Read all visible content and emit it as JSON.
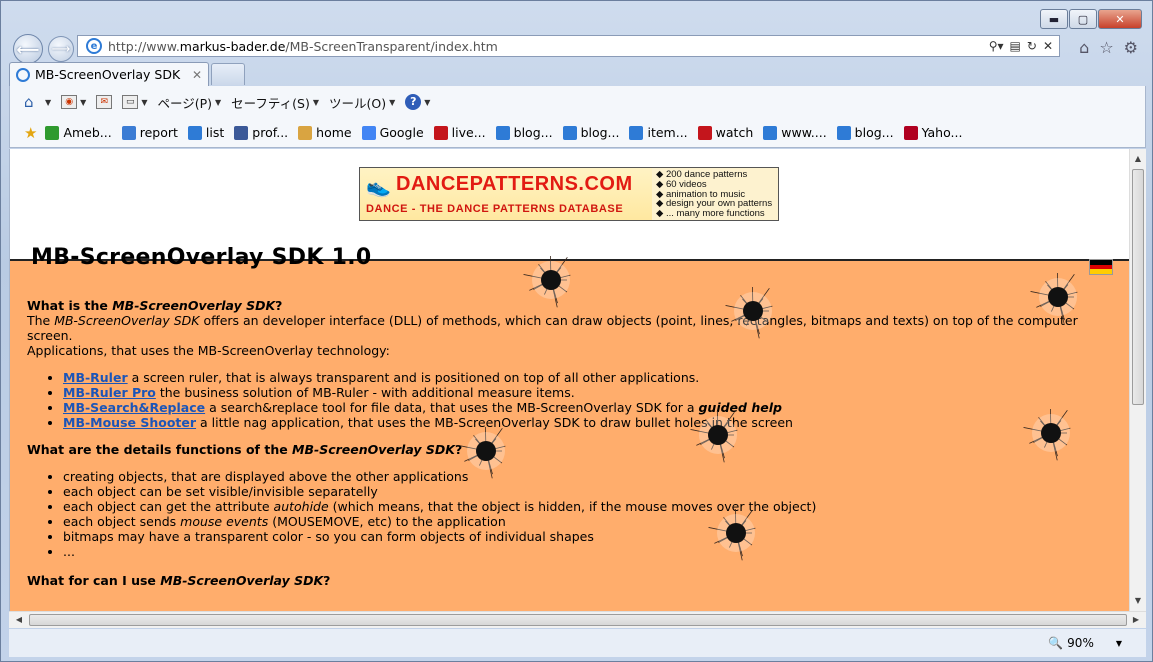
{
  "window": {
    "minimize_label": "▬",
    "maximize_label": "▢",
    "close_label": "✕"
  },
  "address": {
    "url_prefix": "http://www.",
    "url_host": "markus-bader.de",
    "url_path": "/MB-ScreenTransparent/index.htm"
  },
  "tab": {
    "title": "MB-ScreenOverlay SDK",
    "close": "✕"
  },
  "commandbar": {
    "page_label": "ページ(P)",
    "safety_label": "セーフティ(S)",
    "tools_label": "ツール(O)",
    "help_label": "?"
  },
  "favorites": [
    {
      "label": "Ameb...",
      "color": "#2f9a2f",
      "icon": "clover-icon"
    },
    {
      "label": "report",
      "color": "#3b7cd4",
      "icon": "report-icon"
    },
    {
      "label": "list",
      "color": "#2e7bd6",
      "icon": "ie-page-icon"
    },
    {
      "label": "prof...",
      "color": "#3b5998",
      "icon": "facebook-icon"
    },
    {
      "label": "home",
      "color": "#d9a441",
      "icon": "mixi-icon"
    },
    {
      "label": "Google",
      "color": "#4285f4",
      "icon": "google-icon"
    },
    {
      "label": "live...",
      "color": "#c4151c",
      "icon": "live-icon"
    },
    {
      "label": "blog...",
      "color": "#2e7bd6",
      "icon": "ie-page-icon"
    },
    {
      "label": "blog...",
      "color": "#2e7bd6",
      "icon": "ie-page-icon"
    },
    {
      "label": "item...",
      "color": "#2e7bd6",
      "icon": "ie-page-icon"
    },
    {
      "label": "watch",
      "color": "#c4151c",
      "icon": "youtube-icon"
    },
    {
      "label": "www....",
      "color": "#2e7bd6",
      "icon": "ie-page-icon"
    },
    {
      "label": "blog...",
      "color": "#2e7bd6",
      "icon": "ie-page-icon"
    },
    {
      "label": "Yaho...",
      "color": "#b00020",
      "icon": "yahoo-icon"
    }
  ],
  "banner": {
    "title": "DANCEPATTERNS.COM",
    "subtitle": "DANCE - THE DANCE PATTERNS DATABASE",
    "bullets": [
      "◆ 200 dance patterns",
      "◆ 60 videos",
      "◆ animation to music",
      "◆ design your own patterns",
      "◆ ... many more functions"
    ]
  },
  "page": {
    "title": "MB-ScreenOverlay SDK 1.0",
    "q1_prefix": "What is the ",
    "q1_italic": "MB-ScreenOverlay SDK",
    "q1_suffix": "?",
    "intro_prefix": "The ",
    "intro_italic": "MB-ScreenOverlay SDK",
    "intro_rest": " offers an developer interface (DLL) of methods, which can draw objects (point, lines, rectangles, bitmaps and texts) on top of the computer screen.",
    "intro_line2": "Applications, that uses the MB-ScreenOverlay technology:",
    "apps": [
      {
        "link": "MB-Ruler",
        "text": " a screen ruler, that is always transparent and is positioned on top of all other applications."
      },
      {
        "link": "MB-Ruler Pro",
        "text": " the business solution of MB-Ruler - with additional measure items."
      },
      {
        "link": "MB-Search&Replace",
        "text": " a search&replace tool for file data, that uses the MB-ScreenOverlay SDK for a ",
        "em": "guided help"
      },
      {
        "link": "MB-Mouse Shooter",
        "text": " a little nag application, that uses the MB-ScreenOverlay SDK to draw bullet holes in the screen"
      }
    ],
    "q2_prefix": "What are the details functions of the ",
    "q2_italic": "MB-ScreenOverlay SDK",
    "q2_suffix": "?",
    "features": [
      {
        "text": "creating objects, that are displayed above the other applications"
      },
      {
        "text": "each object can be set visible/invisible separatelly"
      },
      {
        "pre": "each object can get the attribute ",
        "em": "autohide",
        "post": " (which means, that the object is hidden, if the mouse moves over the object)"
      },
      {
        "pre": "each object sends ",
        "em": "mouse events",
        "post": " (MOUSEMOVE, etc) to the application"
      },
      {
        "text": "bitmaps may have a transparent color - so you can form objects of individual shapes"
      },
      {
        "text": "..."
      }
    ],
    "q3_prefix": "What for can I use ",
    "q3_italic": "MB-ScreenOverlay SDK",
    "q3_suffix": "?"
  },
  "status": {
    "zoom": "90%"
  },
  "colors": {
    "page_bg": "#ffad6c",
    "link": "#1c55b8",
    "banner_red": "#e21b13"
  }
}
